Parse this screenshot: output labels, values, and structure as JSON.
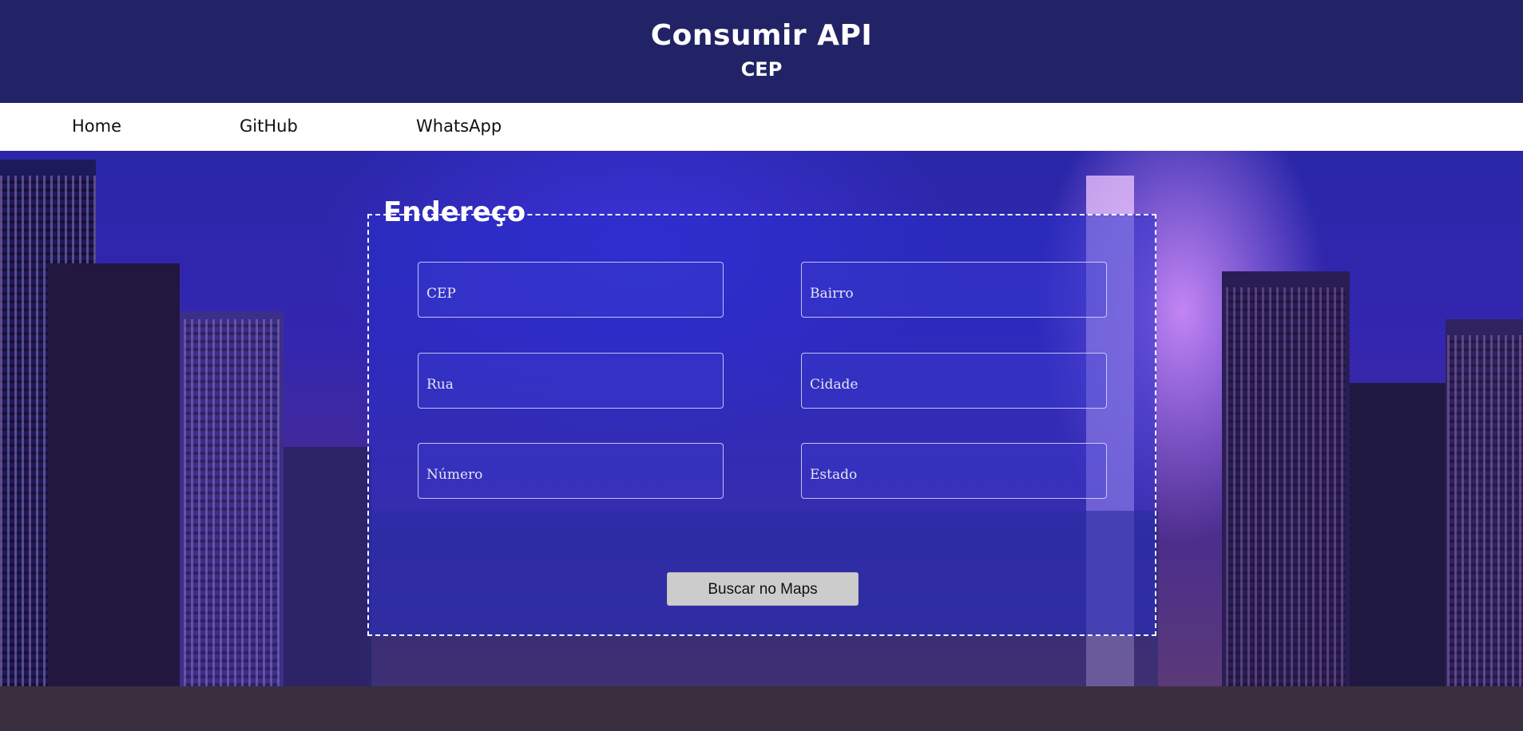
{
  "header": {
    "title": "Consumir API",
    "subtitle": "CEP"
  },
  "nav": {
    "items": [
      {
        "label": "Home"
      },
      {
        "label": "GitHub"
      },
      {
        "label": "WhatsApp"
      }
    ]
  },
  "form": {
    "legend": "Endereço",
    "fields": {
      "cep": {
        "placeholder": "CEP",
        "value": ""
      },
      "bairro": {
        "placeholder": "Bairro",
        "value": ""
      },
      "rua": {
        "placeholder": "Rua",
        "value": ""
      },
      "cidade": {
        "placeholder": "Cidade",
        "value": ""
      },
      "numero": {
        "placeholder": "Número",
        "value": ""
      },
      "estado": {
        "placeholder": "Estado",
        "value": ""
      }
    },
    "button_label": "Buscar no Maps"
  },
  "colors": {
    "header_bg": "#222366",
    "nav_bg": "#ffffff",
    "form_bg": "#2c2dc8",
    "button_bg": "#cccccc",
    "footer_bg": "#3a2f3f"
  },
  "icons": {
    "background": "city-skyline-image"
  }
}
